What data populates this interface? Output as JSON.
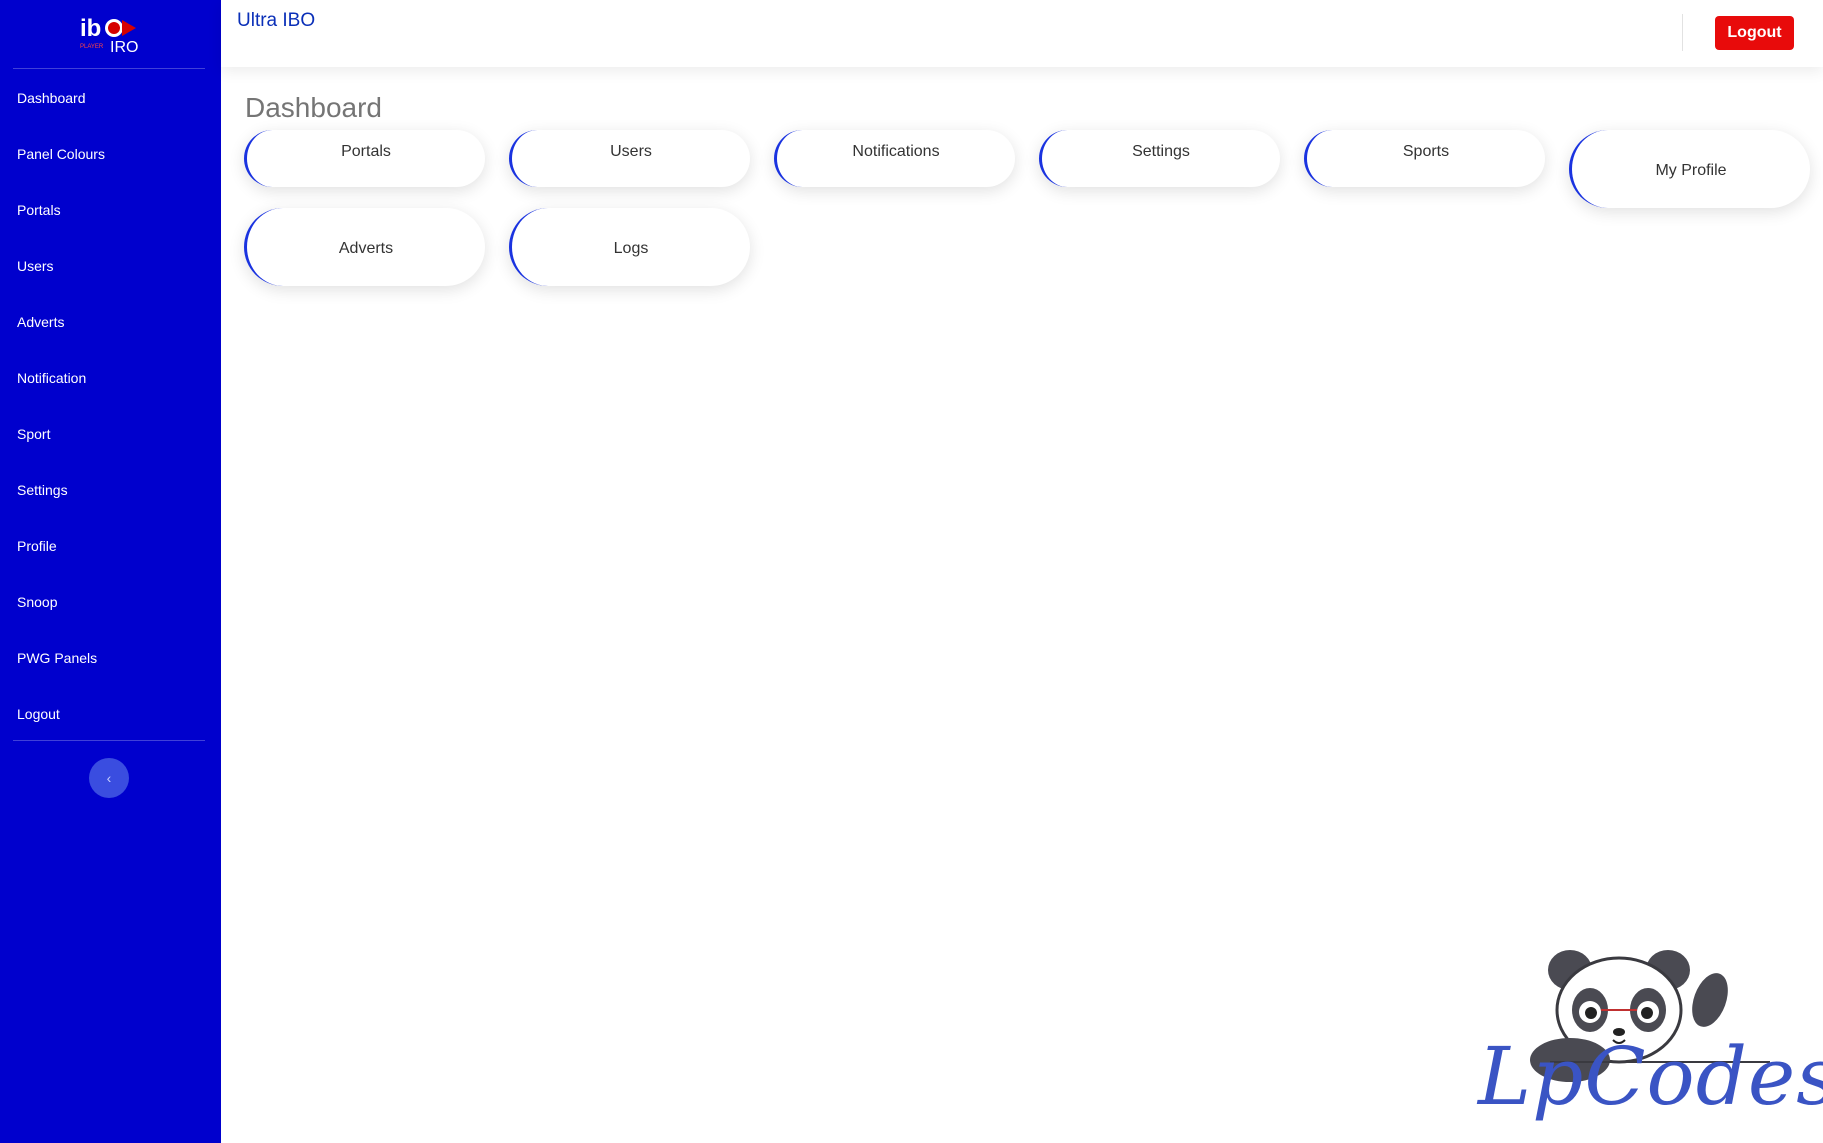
{
  "sidebar": {
    "logo_text": "iboPRO",
    "items": [
      {
        "label": "Dashboard"
      },
      {
        "label": "Panel Colours"
      },
      {
        "label": "Portals"
      },
      {
        "label": "Users"
      },
      {
        "label": "Adverts"
      },
      {
        "label": "Notification"
      },
      {
        "label": "Sport"
      },
      {
        "label": "Settings"
      },
      {
        "label": "Profile"
      },
      {
        "label": "Snoop"
      },
      {
        "label": "PWG Panels"
      },
      {
        "label": "Logout"
      }
    ],
    "collapse_icon": "chevron-left-icon"
  },
  "header": {
    "title": "Ultra IBO",
    "logout_label": "Logout"
  },
  "main": {
    "page_title": "Dashboard",
    "cards": [
      {
        "label": "Portals"
      },
      {
        "label": "Users"
      },
      {
        "label": "Notifications"
      },
      {
        "label": "Settings"
      },
      {
        "label": "Sports"
      },
      {
        "label": "My Profile"
      },
      {
        "label": "Adverts"
      },
      {
        "label": "Logs"
      }
    ]
  },
  "watermark": {
    "text": "LpCodes"
  },
  "colors": {
    "sidebar": "#0000cd",
    "accent": "#1a33e0",
    "logout": "#e80b0b",
    "title": "#0a2fb8"
  }
}
